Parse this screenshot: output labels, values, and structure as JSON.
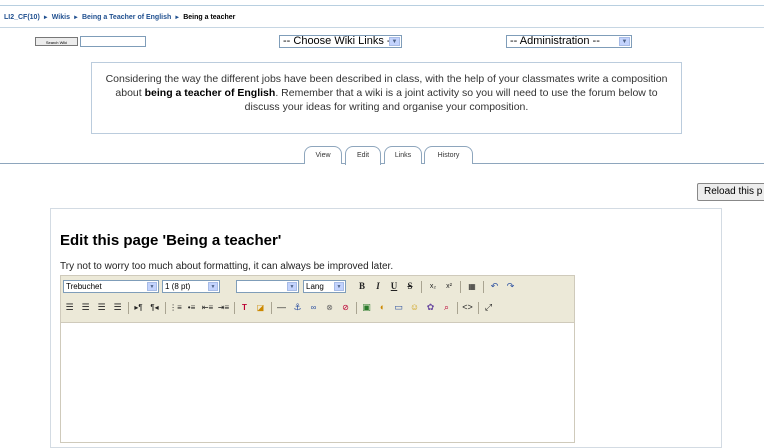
{
  "breadcrumb": {
    "items": [
      "LI2_CF(10)",
      "Wikis",
      "Being a Teacher of English",
      "Being a teacher"
    ],
    "separator": "►"
  },
  "search": {
    "button_label": "Search Wiki",
    "value": ""
  },
  "wiki_links_select": {
    "selected": "-- Choose Wiki Links --"
  },
  "admin_select": {
    "selected": "-- Administration --"
  },
  "intro": {
    "part1": "Considering the way the different jobs have been described in class, with the help of your classmates write a composition about ",
    "bold": "being a teacher of English",
    "part2": ". Remember that a wiki is a joint activity so you will need to use the forum below to discuss your ideas for writing and organise your composition."
  },
  "tabs": [
    "View",
    "Edit",
    "Links",
    "History"
  ],
  "reload_button": "Reload this p",
  "edit": {
    "title": "Edit this page 'Being a teacher'",
    "note": "Try not to worry too much about formatting, it can always be improved later."
  },
  "toolbar": {
    "font_select": "Trebuchet",
    "size_select": "1 (8 pt)",
    "style_select": "",
    "lang_select": "Lang"
  },
  "colors": {
    "accent_link": "#1f4f8f",
    "toolbar_bg": "#ece9d8"
  }
}
